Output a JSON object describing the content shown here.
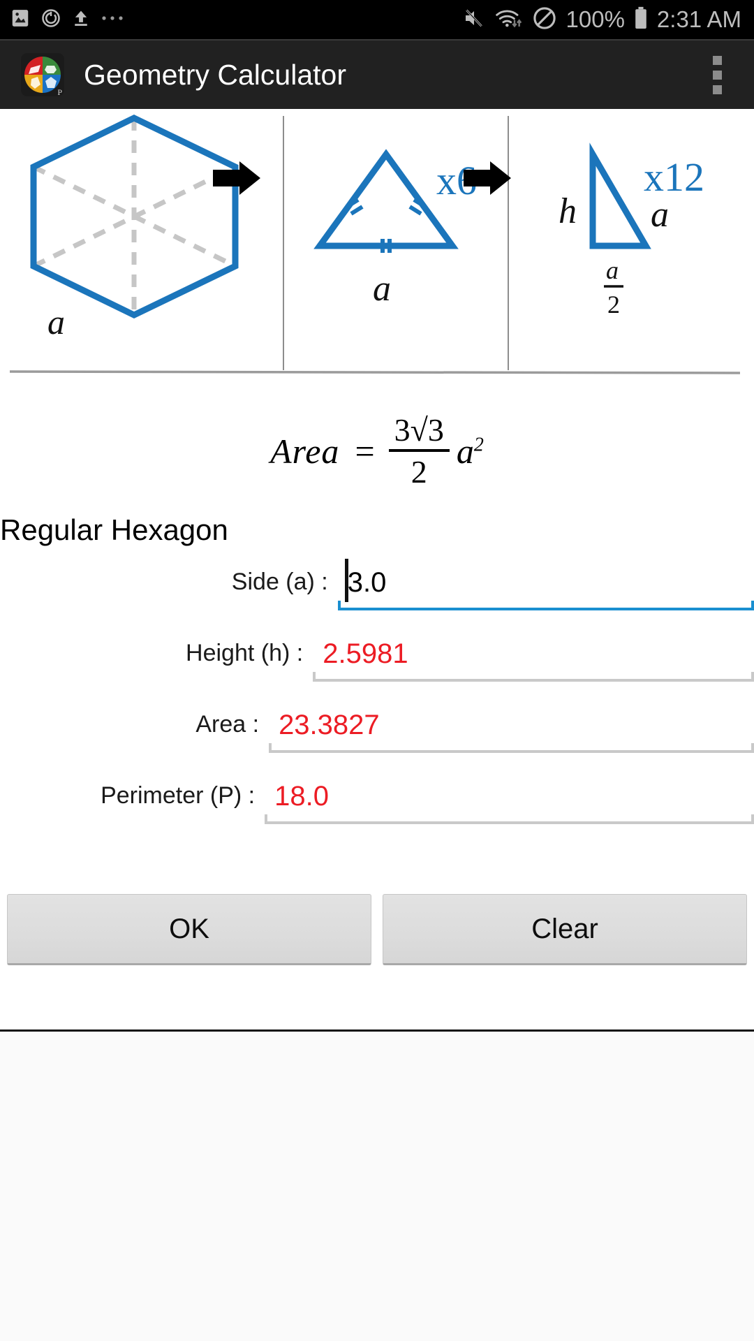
{
  "status_bar": {
    "left_icons": [
      "image-icon",
      "screen-record-icon",
      "upload-icon",
      "more-icon"
    ],
    "right_icons": [
      "mute-icon",
      "wifi-icon",
      "do-not-disturb-icon"
    ],
    "battery_percent": "100%",
    "battery_icon": "battery-full-icon",
    "time": "2:31 AM"
  },
  "app_bar": {
    "icon_name": "geometry-calculator-app-icon",
    "title": "Geometry Calculator",
    "overflow_menu": "overflow-menu-icon"
  },
  "diagram": {
    "panel1": {
      "shape": "regular-hexagon",
      "side_label": "a"
    },
    "panel2": {
      "shape": "equilateral-triangle",
      "multiplier": "x6",
      "side_label": "a"
    },
    "panel3": {
      "shape": "right-triangle",
      "multiplier": "x12",
      "height_label": "h",
      "hypotenuse_label": "a",
      "base_numerator": "a",
      "base_denominator": "2"
    },
    "arrow1": "arrow-right-icon",
    "arrow2": "arrow-right-icon"
  },
  "formula": {
    "lhs": "Area",
    "equals": "=",
    "numerator": "3√3",
    "denominator": "2",
    "variable": "a",
    "exponent": "2"
  },
  "shape_title": "Regular Hexagon",
  "fields": [
    {
      "label": "Side (a) :",
      "value": "3.0",
      "state": "focused"
    },
    {
      "label": "Height (h) :",
      "value": "2.5981",
      "state": "result"
    },
    {
      "label": "Area :",
      "value": "23.3827",
      "state": "result"
    },
    {
      "label": "Perimeter (P) :",
      "value": "18.0",
      "state": "result"
    }
  ],
  "buttons": {
    "ok": "OK",
    "clear": "Clear"
  },
  "colors": {
    "accent_blue": "#1a72c4",
    "result_red": "#ec1c24",
    "focus_underline": "#1a8fd0",
    "app_bar_bg": "#212121",
    "status_bar_bg": "#000000"
  }
}
